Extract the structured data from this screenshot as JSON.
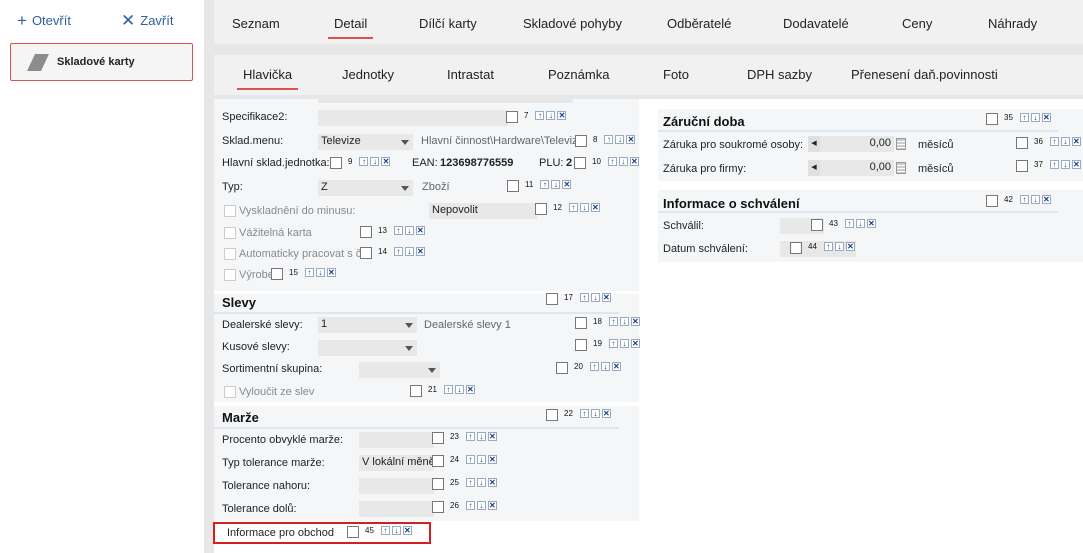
{
  "toolbar": {
    "open": "Otevřít",
    "close": "Zavřít"
  },
  "nav": {
    "item": "Skladové karty"
  },
  "tabs_top": [
    "Seznam",
    "Detail",
    "Dílčí karty",
    "Skladové pohyby",
    "Odběratelé",
    "Dodavatelé",
    "Ceny",
    "Náhrady"
  ],
  "tabs_sub": [
    "Hlavička",
    "Jednotky",
    "Intrastat",
    "Poznámka",
    "Foto",
    "DPH sazby",
    "Přenesení daň.povinnosti"
  ],
  "form": {
    "spec2": {
      "label": "Specifikace2:",
      "n": "7"
    },
    "sklad_menu": {
      "label": "Sklad.menu:",
      "value": "Televize",
      "path": "Hlavní činnost\\Hardware\\Televiz",
      "n": "8"
    },
    "hlavni_sklad": {
      "label": "Hlavní sklad.jednotka:",
      "n": "9",
      "ean_label": "EAN:",
      "ean_value": "123698776559",
      "plu_label": "PLU:",
      "plu_value": "2",
      "n2": "10"
    },
    "typ": {
      "label": "Typ:",
      "value": "Z",
      "desc": "Zboží",
      "n": "11"
    },
    "vyskladneni": {
      "label": "Vyskladnění do minusu:",
      "value": "Nepovolit",
      "n": "12"
    },
    "vazitelna": {
      "label": "Vážitelná karta",
      "n": "13"
    },
    "automaticky": {
      "label": "Automaticky pracovat s č",
      "n": "14"
    },
    "vyrobek": {
      "label": "Výrobek",
      "n": "15"
    }
  },
  "slevy": {
    "title": "Slevy",
    "n": "17",
    "dealerske": {
      "label": "Dealerské slevy:",
      "value": "1",
      "desc": "Dealerské slevy 1",
      "n": "18"
    },
    "kusove": {
      "label": "Kusové slevy:",
      "n": "19"
    },
    "sortiment": {
      "label": "Sortimentní skupina:",
      "n": "20"
    },
    "vyloucit": {
      "label": "Vyloučit ze slev",
      "n": "21"
    }
  },
  "marze": {
    "title": "Marže",
    "n": "22",
    "procento": {
      "label": "Procento obvyklé marže:",
      "n": "23"
    },
    "typ_tol": {
      "label": "Typ tolerance marže:",
      "value": "V lokální měně",
      "n": "24"
    },
    "nahoru": {
      "label": "Tolerance nahoru:",
      "n": "25"
    },
    "dolu": {
      "label": "Tolerance dolů:",
      "n": "26"
    }
  },
  "info_obchod": {
    "label": "Informace pro obchod",
    "n": "45"
  },
  "zarucni": {
    "title": "Záruční doba",
    "n": "35",
    "soukrome": {
      "label": "Záruka pro soukromé osoby:",
      "value": "0,00",
      "unit": "měsíců",
      "n": "36"
    },
    "firmy": {
      "label": "Záruka pro firmy:",
      "value": "0,00",
      "unit": "měsíců",
      "n": "37"
    }
  },
  "schvaleni": {
    "title": "Informace o schválení",
    "n": "42",
    "schvalil": {
      "label": "Schválil:",
      "n": "43"
    },
    "datum": {
      "label": "Datum schválení:",
      "n": "44"
    }
  },
  "colors": {
    "accent": "#d9534f",
    "link": "#2e5f9e",
    "highlight": "#d41f1f"
  }
}
